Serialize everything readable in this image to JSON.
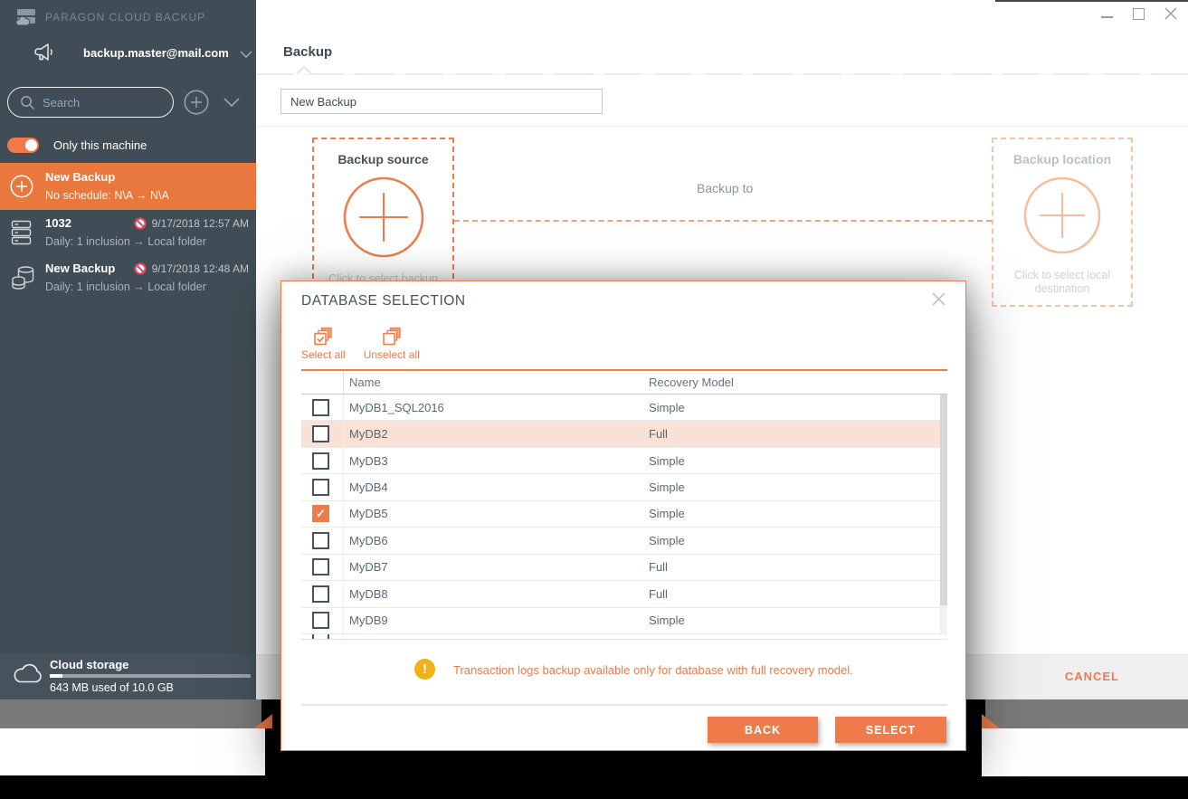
{
  "colors": {
    "accent": "#EF7A4A",
    "sidebar_bg": "#414D56",
    "sidebar_block_bg": "#46535C",
    "selected_item_bg": "#E9783F",
    "row_highlight": "#F8E2D6",
    "warning_yellow": "#F0B216",
    "blocked_red": "#E54760",
    "footer_gray": "#EFEFEF",
    "strip_gray": "#7A7A7A"
  },
  "sidebar": {
    "app_title": "PARAGON CLOUD BACKUP",
    "logo_icon": "server-cloud-logo",
    "account": {
      "icon": "megaphone-icon",
      "email": "backup.master@mail.com",
      "chevron": "chevron-down-icon"
    },
    "search": {
      "icon": "search-icon",
      "placeholder": "Search",
      "add_icon": "plus-circle-icon",
      "expander_icon": "chevron-down-icon"
    },
    "toggle_label": "Only this machine",
    "items": [
      {
        "icon": "plus-circle-icon",
        "title": "New Backup",
        "subtitle": "No schedule: N\\A → N\\A",
        "selected": true
      },
      {
        "icon": "server-icon",
        "title": "1032",
        "blocked_icon": "blocked-icon",
        "date": "9/17/2018 12:57 AM",
        "subtitle": "Daily: 1 inclusion → Local folder"
      },
      {
        "icon": "database-icon",
        "title": "New Backup",
        "blocked_icon": "blocked-icon",
        "date": "9/17/2018 12:48 AM",
        "subtitle": "Daily: 1 inclusion → Local folder"
      }
    ],
    "cloud_storage": {
      "icon": "cloud-icon",
      "title": "Cloud storage",
      "usage": "643 MB used of 10.0 GB",
      "used_percent": 6.3
    }
  },
  "main": {
    "heading": "Backup",
    "name_input_value": "New Backup",
    "backup_source": {
      "title": "Backup source",
      "plus_icon": "plus-circle-icon",
      "hint": "Click to select backup source"
    },
    "backup_to_label": "Backup to",
    "backup_location": {
      "title": "Backup location",
      "plus_icon": "plus-circle-icon",
      "hint_line1": "Click to select local",
      "hint_line2": "destination"
    },
    "footer": {
      "cancel_label": "CANCEL"
    },
    "window_controls": [
      "minimize-icon",
      "maximize-icon",
      "close-icon"
    ]
  },
  "modal": {
    "title": "DATABASE SELECTION",
    "close_icon": "close-icon",
    "toolbar": {
      "select_all": "Select all",
      "unselect_all": "Unselect all"
    },
    "table": {
      "columns": [
        "Name",
        "Recovery Model"
      ],
      "rows": [
        {
          "name": "MyDB1_SQL2016",
          "recovery_model": "Simple",
          "checked": false,
          "highlighted": false
        },
        {
          "name": "MyDB2",
          "recovery_model": "Full",
          "checked": false,
          "highlighted": true
        },
        {
          "name": "MyDB3",
          "recovery_model": "Simple",
          "checked": false,
          "highlighted": false
        },
        {
          "name": "MyDB4",
          "recovery_model": "Simple",
          "checked": false,
          "highlighted": false
        },
        {
          "name": "MyDB5",
          "recovery_model": "Simple",
          "checked": true,
          "highlighted": false
        },
        {
          "name": "MyDB6",
          "recovery_model": "Simple",
          "checked": false,
          "highlighted": false
        },
        {
          "name": "MyDB7",
          "recovery_model": "Full",
          "checked": false,
          "highlighted": false
        },
        {
          "name": "MyDB8",
          "recovery_model": "Full",
          "checked": false,
          "highlighted": false
        },
        {
          "name": "MyDB9",
          "recovery_model": "Simple",
          "checked": false,
          "highlighted": false
        }
      ]
    },
    "warning": {
      "icon": "warning-icon",
      "text": "Transaction logs backup available only for database with full recovery model."
    },
    "buttons": {
      "back": "BACK",
      "select": "SELECT"
    }
  }
}
